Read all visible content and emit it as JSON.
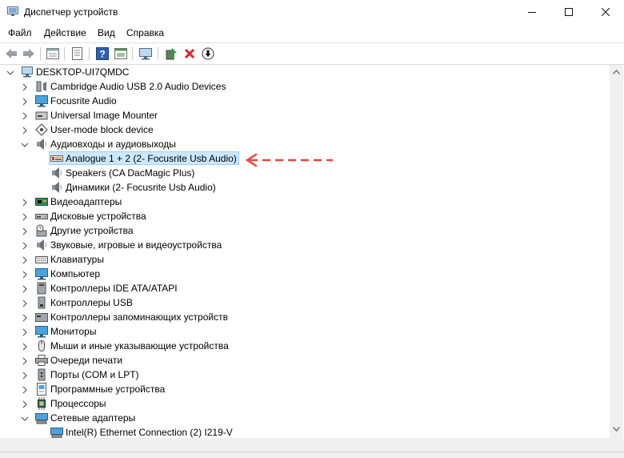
{
  "window": {
    "title": "Диспетчер устройств"
  },
  "menu": [
    "Файл",
    "Действие",
    "Вид",
    "Справка"
  ],
  "toolbar": {
    "icons": [
      "back-arrow-icon",
      "forward-arrow-icon",
      "properties-icon",
      "list-view-icon",
      "help-icon",
      "details-icon",
      "monitor-scan-icon",
      "update-driver-icon",
      "uninstall-icon",
      "disable-device-icon"
    ]
  },
  "tree": {
    "root": "DESKTOP-UI7QMDC",
    "items": [
      {
        "label": "Cambridge Audio USB 2.0 Audio Devices",
        "icon": "usb-audio-icon"
      },
      {
        "label": "Focusrite Audio",
        "icon": "monitor-icon"
      },
      {
        "label": "Universal Image Mounter",
        "icon": "disk-mounter-icon"
      },
      {
        "label": "User-mode block device",
        "icon": "block-device-icon"
      },
      {
        "label": "Аудиовходы и аудиовыходы",
        "icon": "speaker-icon",
        "expanded": true,
        "children": [
          {
            "label": "Analogue 1 + 2 (2- Focusrite Usb Audio)",
            "icon": "microphone-icon",
            "selected": true
          },
          {
            "label": "Speakers (CA DacMagic Plus)",
            "icon": "speaker-icon"
          },
          {
            "label": "Динамики (2- Focusrite Usb Audio)",
            "icon": "speaker-icon"
          }
        ]
      },
      {
        "label": "Видеоадаптеры",
        "icon": "video-adapter-icon"
      },
      {
        "label": "Дисковые устройства",
        "icon": "disk-drive-icon"
      },
      {
        "label": "Другие устройства",
        "icon": "unknown-device-icon"
      },
      {
        "label": "Звуковые, игровые и видеоустройства",
        "icon": "speaker-icon"
      },
      {
        "label": "Клавиатуры",
        "icon": "keyboard-icon"
      },
      {
        "label": "Компьютер",
        "icon": "computer-icon"
      },
      {
        "label": "Контроллеры IDE ATA/ATAPI",
        "icon": "ide-controller-icon"
      },
      {
        "label": "Контроллеры USB",
        "icon": "usb-controller-icon"
      },
      {
        "label": "Контроллеры запоминающих устройств",
        "icon": "storage-controller-icon"
      },
      {
        "label": "Мониторы",
        "icon": "monitor-icon"
      },
      {
        "label": "Мыши и иные указывающие устройства",
        "icon": "mouse-icon"
      },
      {
        "label": "Очереди печати",
        "icon": "printer-icon"
      },
      {
        "label": "Порты (COM и LPT)",
        "icon": "port-icon"
      },
      {
        "label": "Программные устройства",
        "icon": "software-device-icon"
      },
      {
        "label": "Процессоры",
        "icon": "processor-icon"
      },
      {
        "label": "Сетевые адаптеры",
        "icon": "network-adapter-icon",
        "expanded": true,
        "children": [
          {
            "label": "Intel(R) Ethernet Connection (2) I219-V",
            "icon": "network-adapter-icon"
          }
        ]
      }
    ]
  },
  "annotation": {
    "arrow_color": "#e8453c"
  },
  "colors": {
    "selection_bg": "#cce8ff",
    "selection_border": "#99d1ff"
  }
}
